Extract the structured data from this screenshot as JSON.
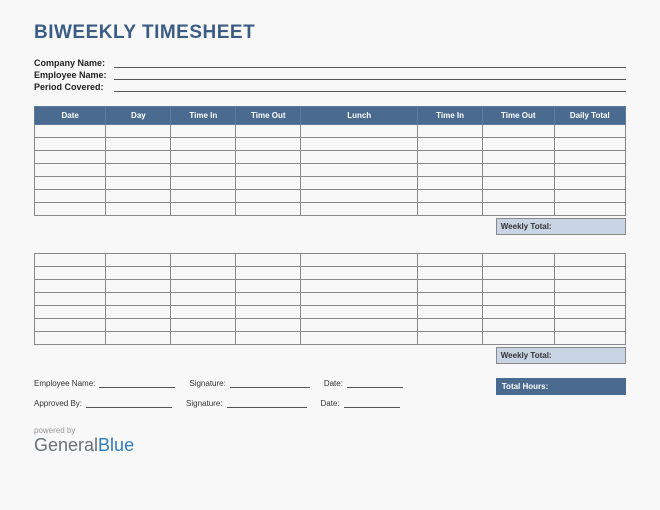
{
  "title": "BIWEEKLY TIMESHEET",
  "info": {
    "company_label": "Company Name:",
    "employee_label": "Employee Name:",
    "period_label": "Period Covered:"
  },
  "table": {
    "headers": {
      "date": "Date",
      "day": "Day",
      "time_in_1": "Time In",
      "time_out_1": "Time Out",
      "lunch": "Lunch",
      "time_in_2": "Time In",
      "time_out_2": "Time Out",
      "daily_total": "Daily Total"
    },
    "weekly_total_label": "Weekly Total:"
  },
  "signatures": {
    "employee_name": "Employee Name:",
    "approved_by": "Approved By:",
    "signature": "Signature:",
    "date": "Date:"
  },
  "total_hours_label": "Total Hours:",
  "powered_by": "powered by",
  "brand_part1": "General",
  "brand_part2": "Blue"
}
